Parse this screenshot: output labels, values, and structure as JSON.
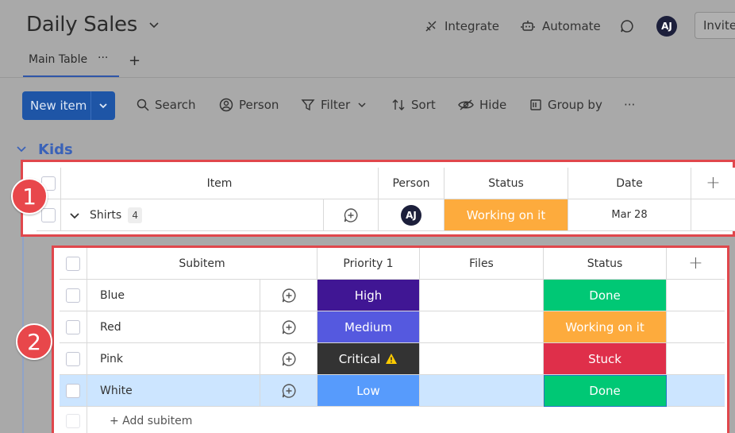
{
  "board": {
    "title": "Daily Sales"
  },
  "header": {
    "integrate_label": "Integrate",
    "automate_label": "Automate",
    "avatar_initials": "AJ",
    "invite_label": "Invite"
  },
  "tabs": [
    {
      "label": "Main Table",
      "more": "···"
    }
  ],
  "toolbar": {
    "new_item_label": "New item",
    "search_label": "Search",
    "person_label": "Person",
    "filter_label": "Filter",
    "sort_label": "Sort",
    "hide_label": "Hide",
    "group_by_label": "Group by",
    "more_label": "···"
  },
  "group": {
    "title": "Kids",
    "color": "#3a62b8"
  },
  "badges": {
    "first": "1",
    "second": "2",
    "color": "#e8474b"
  },
  "items_table": {
    "columns": [
      "Item",
      "Person",
      "Status",
      "Date"
    ],
    "row": {
      "name": "Shirts",
      "subitem_count": "4",
      "person_initials": "AJ",
      "status": "Working on it",
      "status_color": "#fdab3d",
      "date": "Mar 28"
    }
  },
  "subitems_table": {
    "columns": [
      "Subitem",
      "Priority 1",
      "Files",
      "Status"
    ],
    "rows": [
      {
        "name": "Blue",
        "priority": "High",
        "priority_color": "#401694",
        "status": "Done",
        "status_color": "#00c875"
      },
      {
        "name": "Red",
        "priority": "Medium",
        "priority_color": "#5559df",
        "status": "Working on it",
        "status_color": "#fdab3d"
      },
      {
        "name": "Pink",
        "priority": "Critical",
        "priority_color": "#333333",
        "status": "Stuck",
        "status_color": "#df2f4a"
      },
      {
        "name": "White",
        "priority": "Low",
        "priority_color": "#579bfc",
        "status": "Done",
        "status_color": "#00c875"
      }
    ],
    "add_label": "+ Add subitem",
    "selected_row_color": "#cce5ff"
  }
}
